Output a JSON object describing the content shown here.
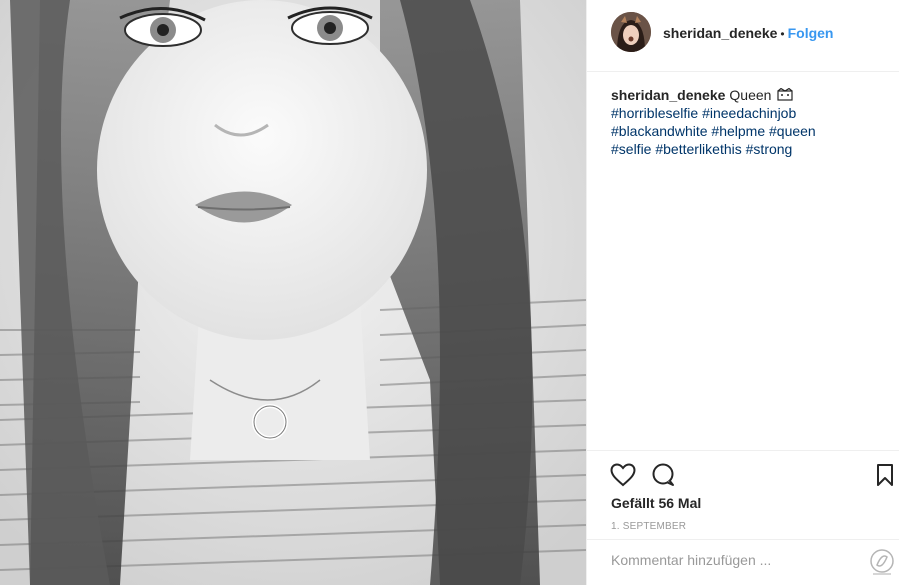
{
  "post": {
    "image_alt": "selfie",
    "username": "sheridan_deneke",
    "separator": "•",
    "follow_label": "Folgen",
    "caption": {
      "username": "sheridan_deneke",
      "text": "Queen",
      "emoji_icon": "crown-icon",
      "hashtags_line1": [
        "#horribleselfie",
        "#ineedachinjob"
      ],
      "hashtags_line2": [
        "#blackandwhite",
        "#helpme",
        "#queen"
      ],
      "hashtags_line3": [
        "#selfie",
        "#betterlikethis",
        "#strong"
      ]
    },
    "likes_label": "Gefällt 56 Mal",
    "date_label": "1. SEPTEMBER",
    "comment_placeholder": "Kommentar hinzufügen ..."
  },
  "icons": {
    "like": "heart-icon",
    "comment": "comment-icon",
    "save": "bookmark-icon",
    "extension": "swirl-icon"
  },
  "colors": {
    "link": "#3897f0",
    "hashtag": "#003569",
    "muted": "#999999",
    "border": "#efefef"
  }
}
